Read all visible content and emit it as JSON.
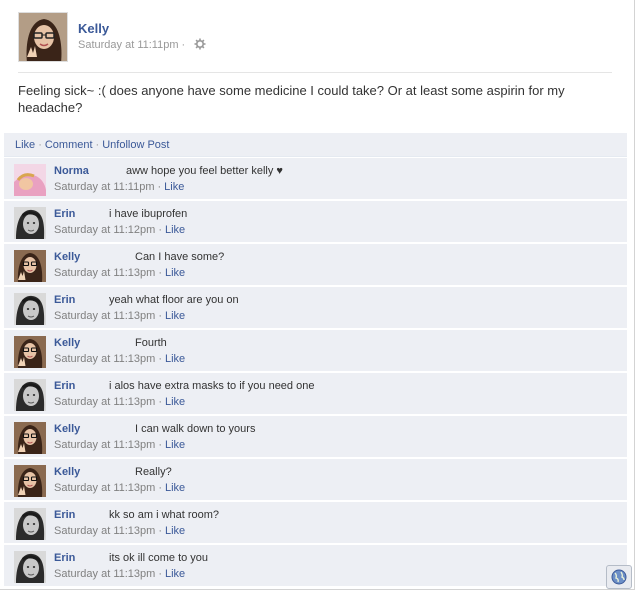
{
  "post": {
    "author": "Kelly",
    "timestamp": "Saturday at 11:11pm",
    "meta_separator": "·",
    "body": "Feeling sick~ :( does anyone have some medicine I could take? Or at least some aspirin for my headache?"
  },
  "actions": {
    "like": "Like",
    "comment": "Comment",
    "unfollow": "Unfollow Post",
    "separator": "·"
  },
  "comments": [
    {
      "author": "Norma",
      "avatar": "norma",
      "text": "aww hope you feel better kelly ♥",
      "time": "Saturday at 11:11pm",
      "like": "Like"
    },
    {
      "author": "Erin",
      "avatar": "erin",
      "text": "i have ibuprofen",
      "time": "Saturday at 11:12pm",
      "like": "Like"
    },
    {
      "author": "Kelly",
      "avatar": "kelly",
      "text": "Can I have some?",
      "time": "Saturday at 11:13pm",
      "like": "Like"
    },
    {
      "author": "Erin",
      "avatar": "erin",
      "text": "yeah what floor are you on",
      "time": "Saturday at 11:13pm",
      "like": "Like"
    },
    {
      "author": "Kelly",
      "avatar": "kelly",
      "text": "Fourth",
      "time": "Saturday at 11:13pm",
      "like": "Like"
    },
    {
      "author": "Erin",
      "avatar": "erin",
      "text": "i alos have extra masks to if you need one",
      "time": "Saturday at 11:13pm",
      "like": "Like"
    },
    {
      "author": "Kelly",
      "avatar": "kelly",
      "text": "I can walk down to yours",
      "time": "Saturday at 11:13pm",
      "like": "Like"
    },
    {
      "author": "Kelly",
      "avatar": "kelly",
      "text": "Really?",
      "time": "Saturday at 11:13pm",
      "like": "Like"
    },
    {
      "author": "Erin",
      "avatar": "erin",
      "text": "kk so am i what room?",
      "time": "Saturday at 11:13pm",
      "like": "Like"
    },
    {
      "author": "Erin",
      "avatar": "erin",
      "text": "its ok ill come to you",
      "time": "Saturday at 11:13pm",
      "like": "Like"
    }
  ],
  "meta_dot": "·",
  "icons": {
    "settings": "gear-icon",
    "chat": "globe-icon"
  },
  "colors": {
    "link": "#3b5998",
    "comment_bg": "#edeff4",
    "meta_text": "#808080"
  }
}
